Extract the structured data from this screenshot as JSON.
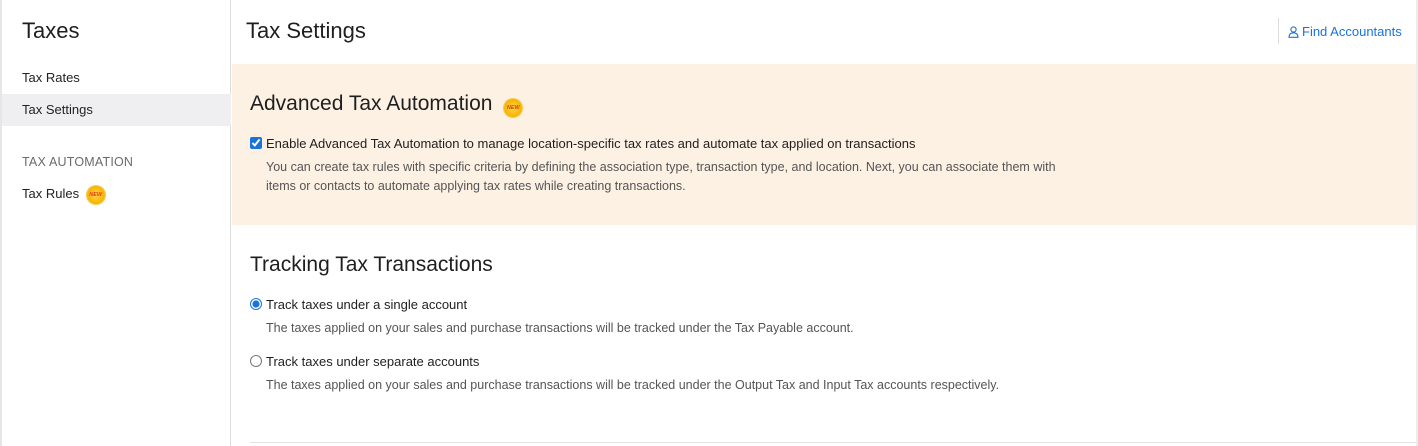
{
  "sidebar": {
    "title": "Taxes",
    "items": [
      {
        "label": "Tax Rates"
      },
      {
        "label": "Tax Settings"
      }
    ],
    "section_label": "TAX AUTOMATION",
    "tax_rules_label": "Tax Rules",
    "new_badge_text": "NEW"
  },
  "header": {
    "title": "Tax Settings",
    "find_accountants_label": "Find Accountants",
    "find_accountants_icon": "user-icon"
  },
  "automation": {
    "title": "Advanced Tax Automation",
    "badge_text": "NEW",
    "checkbox_label": "Enable Advanced Tax Automation to manage location-specific tax rates and automate tax applied on transactions",
    "checkbox_checked": true,
    "help_line1": "You can create tax rules with specific criteria by defining the association type, transaction type, and location. Next, you can associate them with",
    "help_line2": "items or contacts to automate applying tax rates while creating transactions.",
    "panel_color": "#fdf1e4"
  },
  "tracking": {
    "title": "Tracking Tax Transactions",
    "options": [
      {
        "label": "Track taxes under a single account",
        "help": "The taxes applied on your sales and purchase transactions will be tracked under the Tax Payable account.",
        "selected": true
      },
      {
        "label": "Track taxes under separate accounts",
        "help": "The taxes applied on your sales and purchase transactions will be tracked under the Output Tax and Input Tax accounts respectively.",
        "selected": false
      }
    ]
  },
  "colors": {
    "accent": "#1a73d9",
    "active_item_bg": "#efeff1"
  }
}
